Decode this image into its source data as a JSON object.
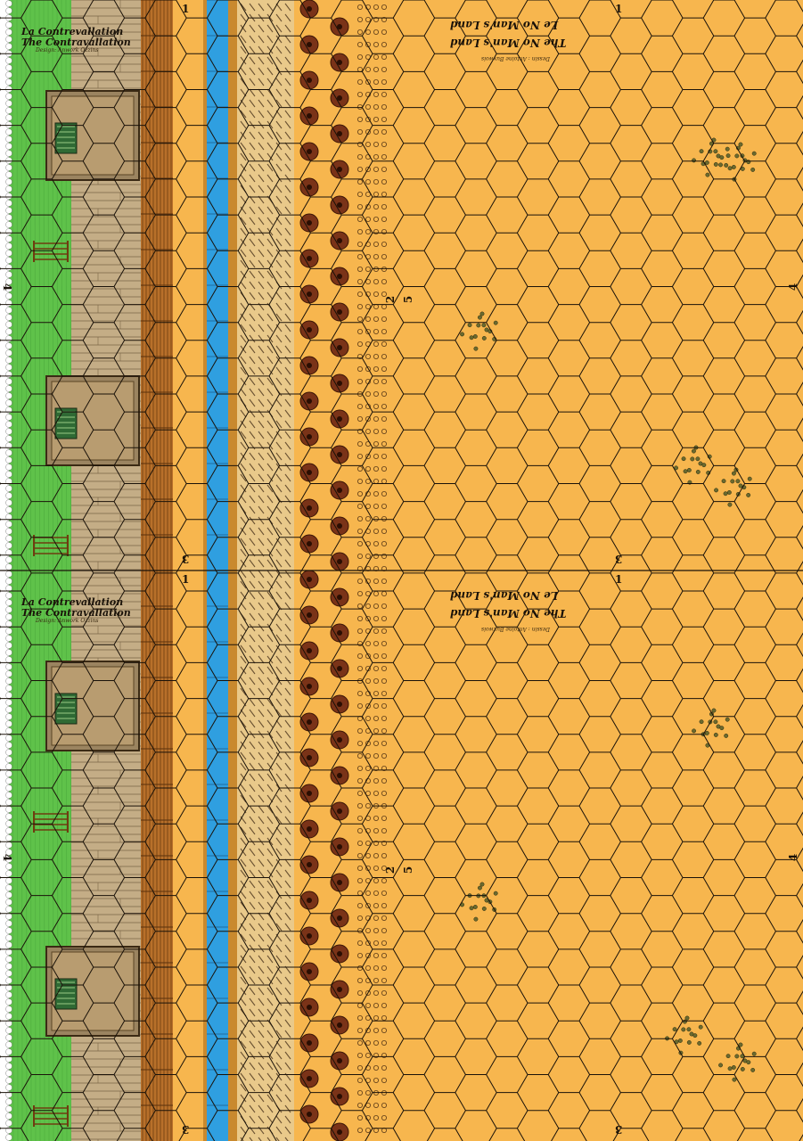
{
  "sections": [
    {
      "left_title_fr": "La Contrevallation",
      "left_title_en": "The Contravallation",
      "left_credit": "Design: Anwork Ozzins",
      "right_title_fr": "Le No Man's Land",
      "right_title_en": "The No Man's Land",
      "right_credit": "Dessin : Antoine Buxwois",
      "edge_numbers": {
        "top_left": "1",
        "top_right": "1",
        "bottom_left": "3",
        "bottom_right": "3",
        "left": "4",
        "right": "4",
        "mid_a": "2",
        "mid_b": "5"
      }
    },
    {
      "left_title_fr": "La Contrevallation",
      "left_title_en": "The Contravallation",
      "left_credit": "Design: Anwork Ozzins",
      "right_title_fr": "Le No Man's Land",
      "right_title_en": "The No Man's Land",
      "right_credit": "Dessin : Antoine Buxwois",
      "edge_numbers": {
        "top_left": "1",
        "top_right": "1",
        "bottom_left": "3",
        "bottom_right": "3",
        "left": "4",
        "right": "4",
        "mid_a": "2",
        "mid_b": "5"
      }
    }
  ],
  "colors": {
    "grass": "#5fc24a",
    "grass_dark": "#3e9a33",
    "planks": "#c4ad86",
    "palisade": "#b8702a",
    "road": "#f7b64e",
    "water": "#2f9fe0",
    "field": "#f7b64e",
    "hex_line": "#1a1209"
  }
}
